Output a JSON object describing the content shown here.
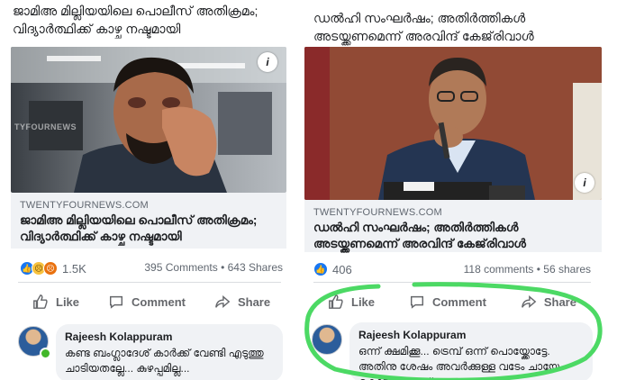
{
  "posts": [
    {
      "headline": "ജാമിഅ മില്ലിയയിലെ പൊലീസ് അതിക്രമം; വിദ്യാർത്ഥിക്ക് കാഴ്ച നഷ്ടമായി",
      "watermark": "TYFOURNEWS",
      "domain": "TWENTYFOURNEWS.COM",
      "link_title": "ജാമിഅ മില്ലിയയിലെ പൊലീസ് അതിക്രമം; വിദ്യാർത്ഥിക്ക് കാഴ്ച നഷ്ടമായി",
      "reaction_count": "1.5K",
      "stats": "395 Comments • 643 Shares",
      "actions": {
        "like": "Like",
        "comment": "Comment",
        "share": "Share"
      },
      "comment": {
        "author": "Rajeesh Kolappuram",
        "text": "കണ്ട ബംഗ്ലാദേശ് കാർക്ക് വേണ്ടി എടുത്തു ചാടിയതല്ലേ... കുഴപ്പമില്ല..."
      }
    },
    {
      "headline": "ഡൽഹി സംഘർഷം; അതിർത്തികൾ അടയ്ക്കണമെന്ന് അരവിന്ദ് കേജ്‌രിവാൾ",
      "domain": "TWENTYFOURNEWS.COM",
      "link_title": "ഡൽഹി സംഘർഷം; അതിർത്തികൾ അടയ്ക്കണമെന്ന് അരവിന്ദ് കേജ്‌രിവാൾ",
      "reaction_count": "406",
      "stats": "118 comments • 56 shares",
      "actions": {
        "like": "Like",
        "comment": "Comment",
        "share": "Share"
      },
      "comment": {
        "author": "Rajeesh Kolappuram",
        "text": "ഒന്ന് ക്ഷമിക്കൂ... ട്രെമ്പ് ഒന്ന് പൊയ്ക്കോട്ടേ. അതിനു ശേഷം അവർക്കുള്ള വടേം ചായേം കൊടുക്കുന്നുണ്ട്"
      }
    }
  ],
  "colors": {
    "accent": "#1877f2",
    "annotation": "#4cd964",
    "online": "#42b72a"
  }
}
